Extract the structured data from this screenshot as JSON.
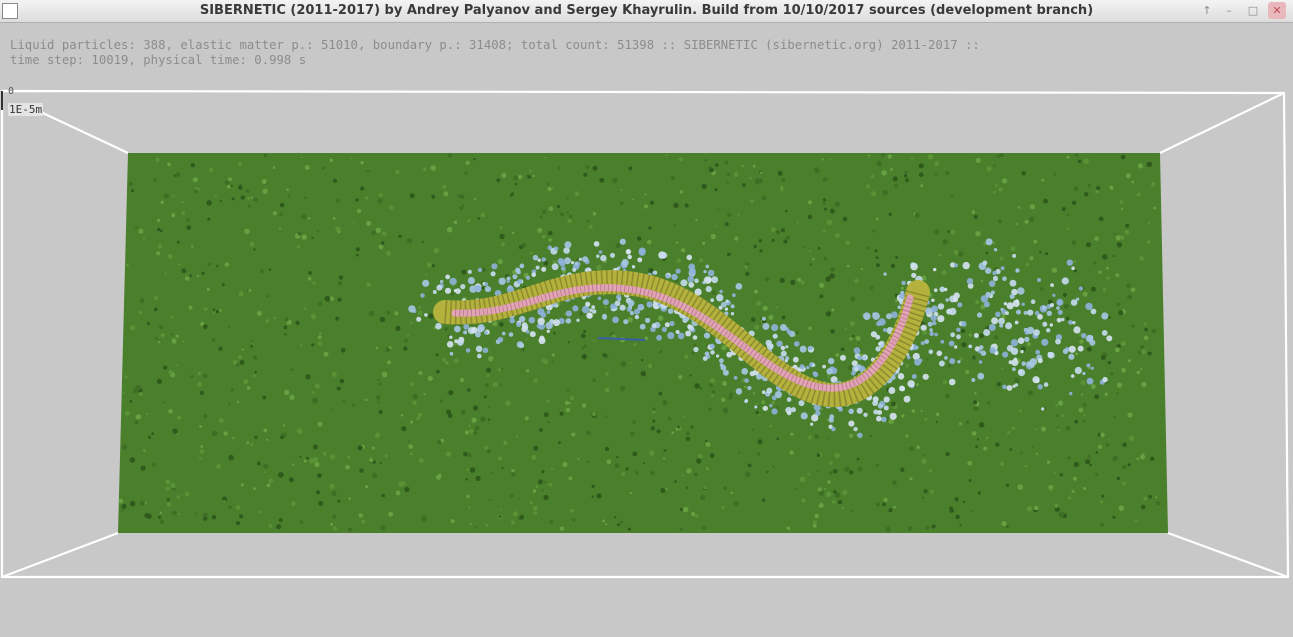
{
  "window": {
    "title": "SIBERNETIC (2011-2017) by Andrey Palyanov and Sergey Khayrulin. Build from 10/10/2017 sources (development branch)",
    "controls": [
      "↑",
      "–",
      "□",
      "✕"
    ]
  },
  "info": {
    "line1": "Liquid particles: 388, elastic matter p.: 51010, boundary p.: 31408; total count: 51398 :: SIBERNETIC (sibernetic.org) 2011-2017 ::",
    "line2": "time step: 10019, physical time: 0.998 s"
  },
  "scale": {
    "zero": "0",
    "label": "1E-5m"
  },
  "scene": {
    "boundary_color": "#ffffff",
    "elastic_color": "#4a7f2c",
    "liquid_color": "#a9c6e6",
    "worm_body_color": "#b4b23c",
    "worm_stripe_color": "#e8a6c8"
  }
}
